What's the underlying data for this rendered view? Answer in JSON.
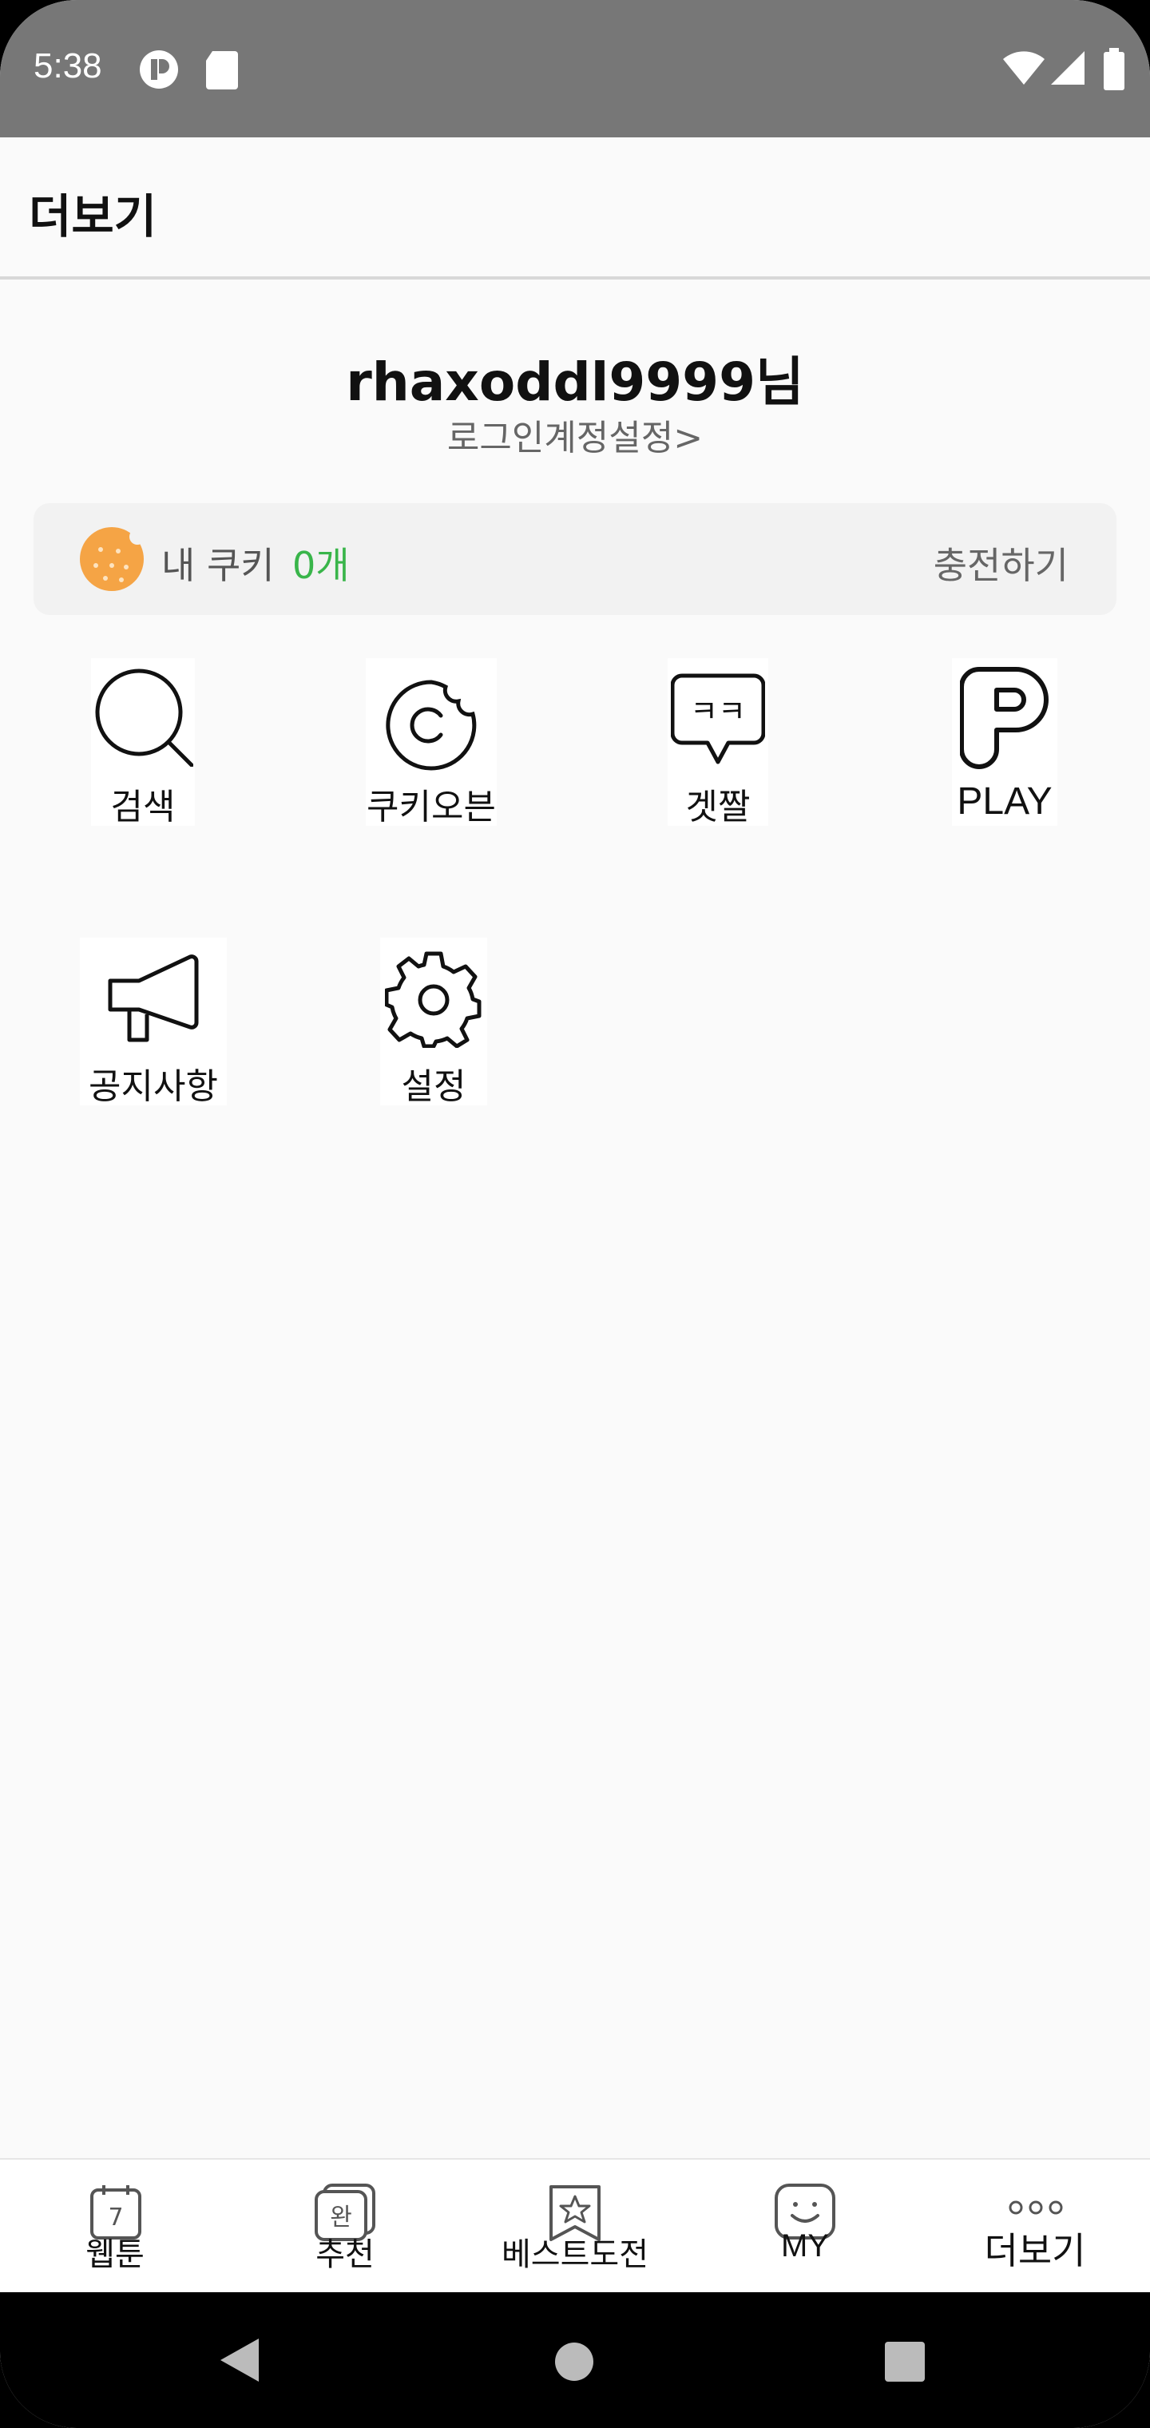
{
  "status_bar": {
    "time": "5:38",
    "icons": [
      "notification-p-icon",
      "sd-card-icon",
      "wifi-icon",
      "signal-icon",
      "battery-icon"
    ]
  },
  "header": {
    "title": "더보기"
  },
  "profile": {
    "username": "rhaxoddl9999님",
    "account_link": "로그인계정설정>"
  },
  "cookie": {
    "label": "내 쿠키",
    "count": "0개",
    "charge_label": "충전하기",
    "count_color": "#39b54a",
    "icon_color": "#f5a445"
  },
  "menu": {
    "items": [
      {
        "label": "검색",
        "icon": "search-icon"
      },
      {
        "label": "쿠키오븐",
        "icon": "cookie-oven-icon"
      },
      {
        "label": "겟짤",
        "icon": "chat-bubble-icon"
      },
      {
        "label": "PLAY",
        "icon": "play-p-icon"
      },
      {
        "label": "공지사항",
        "icon": "megaphone-icon"
      },
      {
        "label": "설정",
        "icon": "gear-icon"
      }
    ]
  },
  "bottom_nav": {
    "items": [
      {
        "label": "웹툰",
        "icon": "calendar-icon",
        "badge": "7"
      },
      {
        "label": "추천",
        "icon": "complete-icon",
        "badge": "완"
      },
      {
        "label": "베스트도전",
        "icon": "star-bookmark-icon"
      },
      {
        "label": "MY",
        "icon": "smile-icon"
      },
      {
        "label": "더보기",
        "icon": "more-dots-icon",
        "active": true
      }
    ]
  },
  "system_nav": {
    "icons": [
      "back-icon",
      "home-icon",
      "recents-icon"
    ]
  }
}
